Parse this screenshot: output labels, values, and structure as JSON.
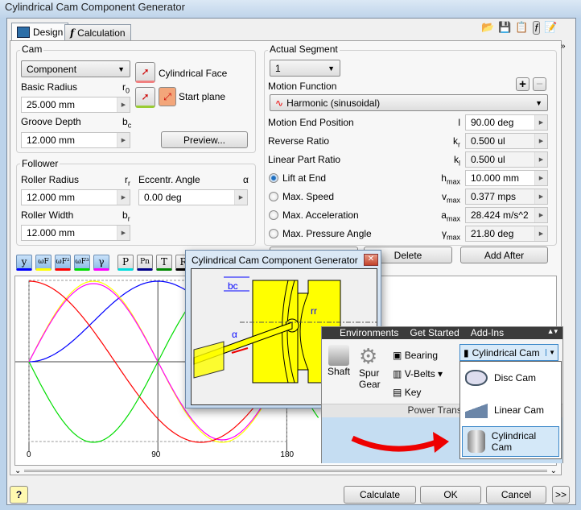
{
  "window": {
    "title": "Cylindrical Cam Component Generator"
  },
  "tabs": [
    {
      "label": "Design"
    },
    {
      "label": "Calculation"
    }
  ],
  "toolbar_icons": [
    "open-icon",
    "save-icon",
    "options-icon",
    "calculation-icon",
    "notes-icon"
  ],
  "cam": {
    "group_label": "Cam",
    "type_value": "Component",
    "cylindrical_face_label": "Cylindrical Face",
    "start_plane_label": "Start plane",
    "basic_radius": {
      "label": "Basic Radius",
      "symbol": "r",
      "sub": "0",
      "value": "25.000 mm"
    },
    "groove_depth": {
      "label": "Groove Depth",
      "symbol": "b",
      "sub": "c",
      "value": "12.000 mm"
    },
    "preview_label": "Preview..."
  },
  "follower": {
    "group_label": "Follower",
    "roller_radius": {
      "label": "Roller Radius",
      "symbol": "r",
      "sub": "r",
      "value": "12.000 mm"
    },
    "eccentr_angle": {
      "label": "Eccentr. Angle",
      "symbol": "α",
      "value": "0.00 deg"
    },
    "roller_width": {
      "label": "Roller Width",
      "symbol": "b",
      "sub": "r",
      "value": "12.000 mm"
    }
  },
  "segment": {
    "group_label": "Actual Segment",
    "segment_value": "1",
    "motion_function_label": "Motion Function",
    "motion_function_value": "Harmonic (sinusoidal)",
    "rows": [
      {
        "label": "Motion End Position",
        "symbol": "l",
        "sub": "",
        "value": "90.00 deg",
        "radio": false,
        "readonly": false
      },
      {
        "label": "Reverse Ratio",
        "symbol": "k",
        "sub": "r",
        "value": "0.500 ul",
        "radio": false,
        "readonly": true
      },
      {
        "label": "Linear Part Ratio",
        "symbol": "k",
        "sub": "l",
        "value": "0.500 ul",
        "radio": false,
        "readonly": true
      },
      {
        "label": "Lift at End",
        "symbol": "h",
        "sub": "max",
        "value": "10.000 mm",
        "radio": true,
        "checked": true,
        "readonly": false
      },
      {
        "label": "Max. Speed",
        "symbol": "v",
        "sub": "max",
        "value": "0.377 mps",
        "radio": true,
        "checked": false,
        "readonly": true
      },
      {
        "label": "Max. Acceleration",
        "symbol": "a",
        "sub": "max",
        "value": "28.424 m/s^2",
        "radio": true,
        "checked": false,
        "readonly": true
      },
      {
        "label": "Max. Pressure Angle",
        "symbol": "γ",
        "sub": "max",
        "value": "21.80 deg",
        "radio": true,
        "checked": false,
        "readonly": true
      }
    ],
    "delete_label": "Delete",
    "add_after_label": "Add After"
  },
  "graph_buttons": [
    "y",
    "ωF",
    "ωF²",
    "ωF³",
    "γ",
    "P",
    "Pn",
    "T",
    "R"
  ],
  "graph": {
    "x_ticks": [
      "0",
      "90",
      "180"
    ],
    "colors": {
      "y": "#0000ff",
      "v": "#ffff00",
      "a": "#ff0000",
      "j": "#00dd00",
      "gamma": "#ff00ff"
    }
  },
  "popup": {
    "title": "Cylindrical Cam Component Generator",
    "dim_bc": "bc",
    "dim_rr": "rr",
    "dim_alpha": "α"
  },
  "ribbon": {
    "tabs": [
      "Environments",
      "Get Started",
      "Add-Ins"
    ],
    "shaft": "Shaft",
    "spur_gear": "Spur Gear",
    "bearing": "Bearing",
    "v_belts": "V-Belts",
    "key": "Key",
    "panel_label": "Power Transmis",
    "split_button": "Cylindrical Cam",
    "menu": [
      {
        "label": "Disc Cam"
      },
      {
        "label": "Linear Cam"
      },
      {
        "label": "Cylindrical Cam"
      }
    ]
  },
  "footer": {
    "calculate": "Calculate",
    "ok": "OK",
    "cancel": "Cancel",
    "more": ">>"
  }
}
